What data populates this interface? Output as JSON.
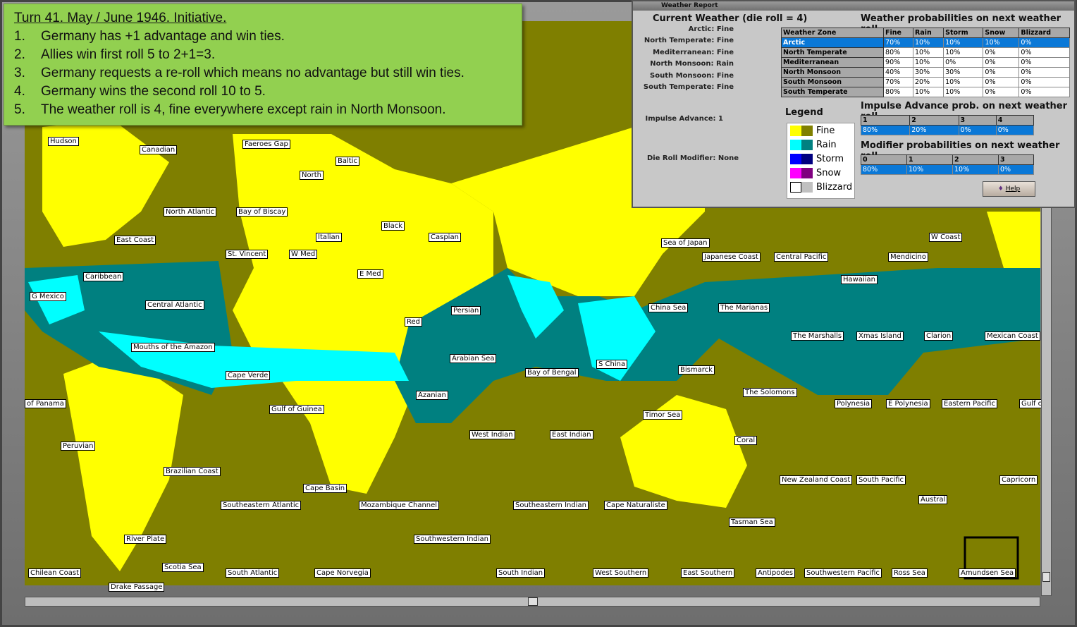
{
  "note": {
    "title": "Turn  41.  May / June 1946.  Initiative.",
    "items": [
      {
        "n": "1.",
        "t": "Germany has +1 advantage and win ties."
      },
      {
        "n": "2.",
        "t": "Allies win first roll 5 to 2+1=3."
      },
      {
        "n": "3.",
        "t": "Germany requests a re-roll which means no advantage but still win ties."
      },
      {
        "n": "4.",
        "t": "Germany wins the second roll 10 to 5."
      },
      {
        "n": "5.",
        "t": "The weather roll is 4, fine everywhere except rain in North Monsoon."
      }
    ]
  },
  "weather": {
    "window_title": "Weather Report",
    "current_heading": "Current Weather (die roll = 4)",
    "current": [
      "Arctic:  Fine",
      "North Temperate:  Fine",
      "Mediterranean:  Fine",
      "North Monsoon:  Rain",
      "South Monsoon:  Fine",
      "South Temperate:  Fine"
    ],
    "impulse": "Impulse Advance:  1",
    "modifier": "Die Roll Modifier:  None",
    "prob_heading": "Weather probabilities on next weather roll",
    "prob_headers": [
      "Weather Zone",
      "Fine",
      "Rain",
      "Storm",
      "Snow",
      "Blizzard"
    ],
    "prob_rows": [
      [
        "Arctic",
        "70%",
        "10%",
        "10%",
        "10%",
        "0%"
      ],
      [
        "North Temperate",
        "80%",
        "10%",
        "10%",
        "0%",
        "0%"
      ],
      [
        "Mediterranean",
        "90%",
        "10%",
        "0%",
        "0%",
        "0%"
      ],
      [
        "North Monsoon",
        "40%",
        "30%",
        "30%",
        "0%",
        "0%"
      ],
      [
        "South Monsoon",
        "70%",
        "20%",
        "10%",
        "0%",
        "0%"
      ],
      [
        "South Temperate",
        "80%",
        "10%",
        "10%",
        "0%",
        "0%"
      ]
    ],
    "legend_heading": "Legend",
    "legend": [
      {
        "label": "Fine",
        "c1": "#ffff00",
        "c2": "#808000"
      },
      {
        "label": "Rain",
        "c1": "#00ffff",
        "c2": "#008080"
      },
      {
        "label": "Storm",
        "c1": "#0000ff",
        "c2": "#000080"
      },
      {
        "label": "Snow",
        "c1": "#ff00ff",
        "c2": "#800080"
      },
      {
        "label": "Blizzard",
        "c1": "#ffffff",
        "c2": "#c0c0c0"
      }
    ],
    "impulse_heading": "Impulse Advance prob. on next weather roll",
    "impulse_headers": [
      "1",
      "2",
      "3",
      "4"
    ],
    "impulse_values": [
      "80%",
      "20%",
      "0%",
      "0%"
    ],
    "mod_heading": "Modifier probabilities on next weather roll",
    "mod_headers": [
      "0",
      "1",
      "2",
      "3"
    ],
    "mod_values": [
      "80%",
      "10%",
      "10%",
      "0%"
    ],
    "help": "Help"
  },
  "map": {
    "labels": [
      "Hudson",
      "Canadian",
      "Faeroes Gap",
      "Baltic",
      "North",
      "North Atlantic",
      "Bay of Biscay",
      "Black",
      "Caspian",
      "Italian",
      "East Coast",
      "St. Vincent",
      "W Med",
      "E Med",
      "Caribbean",
      "G Mexico",
      "Central Atlantic",
      "Persian",
      "Red",
      "Mouths of the Amazon",
      "Arabian Sea",
      "Cape Verde",
      "Bay of Bengal",
      "S China",
      "Azanian",
      "of Panama",
      "Gulf of Guinea",
      "West Indian",
      "East Indian",
      "Peruvian",
      "Brazilian Coast",
      "Cape Basin",
      "Southeastern Atlantic",
      "Mozambique Channel",
      "Southeastern Indian",
      "Cape Naturaliste",
      "Tasman Sea",
      "River Plate",
      "Southwestern Indian",
      "Scotia Sea",
      "Chilean Coast",
      "South Atlantic",
      "Cape Norvegia",
      "South Indian",
      "West Southern",
      "East Southern",
      "Antipodes",
      "Southwestern Pacific",
      "Ross Sea",
      "Amundsen Sea",
      "Drake Passage",
      "Sea of Japan",
      "Japanese Coast",
      "Central Pacific",
      "Mendicino",
      "W Coast",
      "Hawaiian",
      "China Sea",
      "The Marianas",
      "The Marshalls",
      "Xmas Island",
      "Clarion",
      "Mexican Coast",
      "Bismarck",
      "The Solomons",
      "Polynesia",
      "E Polynesia",
      "Eastern Pacific",
      "Gulf of",
      "Timor Sea",
      "Coral",
      "New Zealand Coast",
      "South Pacific",
      "Capricorn",
      "Austral"
    ]
  }
}
